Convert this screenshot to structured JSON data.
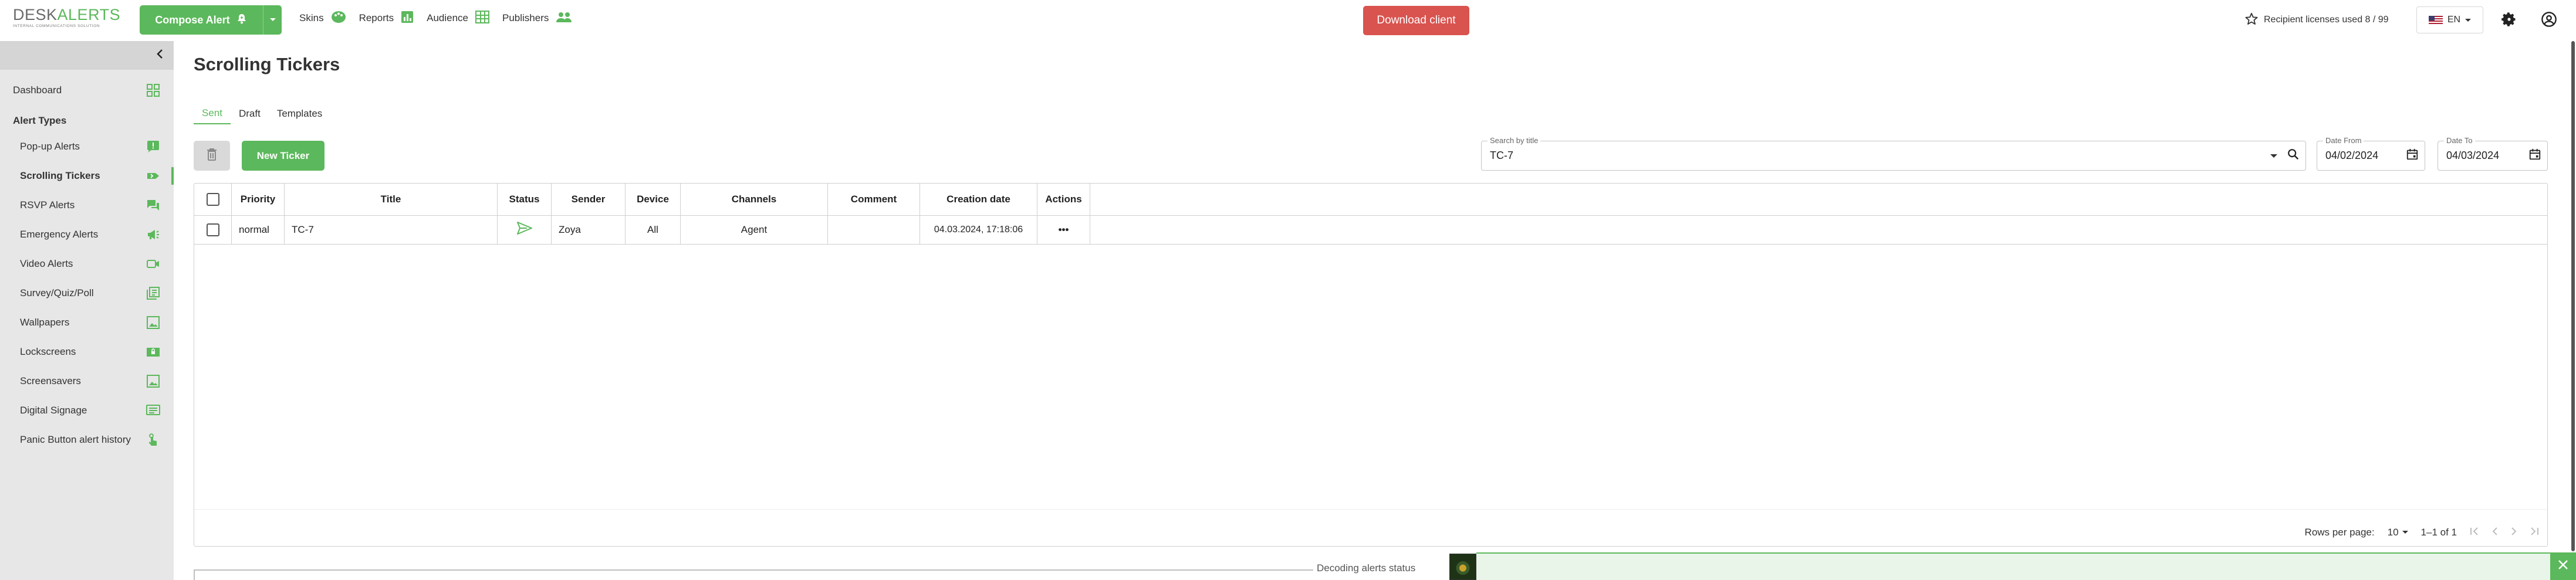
{
  "header": {
    "logo_main_a": "DESK",
    "logo_main_b": "ALERTS",
    "logo_sub": "INTERNAL COMMUNICATIONS SOLUTION",
    "compose_label": "Compose Alert",
    "nav": [
      {
        "label": "Skins",
        "icon": "palette-icon"
      },
      {
        "label": "Reports",
        "icon": "chart-icon"
      },
      {
        "label": "Audience",
        "icon": "table-icon"
      },
      {
        "label": "Publishers",
        "icon": "people-icon"
      }
    ],
    "download_label": "Download client",
    "licenses_label": "Recipient licenses used 8 / 99",
    "language": "EN"
  },
  "sidebar": {
    "dashboard_label": "Dashboard",
    "alert_types_heading": "Alert Types",
    "items": [
      {
        "label": "Pop-up Alerts",
        "icon": "popup-icon"
      },
      {
        "label": "Scrolling Tickers",
        "icon": "ticker-icon",
        "active": true
      },
      {
        "label": "RSVP Alerts",
        "icon": "chat-icon"
      },
      {
        "label": "Emergency Alerts",
        "icon": "megaphone-icon"
      },
      {
        "label": "Video Alerts",
        "icon": "video-icon"
      },
      {
        "label": "Survey/Quiz/Poll",
        "icon": "survey-icon"
      },
      {
        "label": "Wallpapers",
        "icon": "image-icon"
      },
      {
        "label": "Lockscreens",
        "icon": "lockscreen-icon"
      },
      {
        "label": "Screensavers",
        "icon": "screensaver-icon"
      },
      {
        "label": "Digital Signage",
        "icon": "signage-icon"
      },
      {
        "label": "Panic Button alert history",
        "icon": "hand-icon"
      }
    ]
  },
  "main": {
    "title": "Scrolling Tickers",
    "tabs": [
      "Sent",
      "Draft",
      "Templates"
    ],
    "active_tab": "Sent",
    "new_button": "New Ticker",
    "search": {
      "legend": "Search by title",
      "value": "TC-7"
    },
    "date_from": {
      "legend": "Date From",
      "value": "04/02/2024"
    },
    "date_to": {
      "legend": "Date To",
      "value": "04/03/2024"
    },
    "table": {
      "columns": [
        "Priority",
        "Title",
        "Status",
        "Sender",
        "Device",
        "Channels",
        "Comment",
        "Creation date",
        "Actions"
      ],
      "rows": [
        {
          "priority": "normal",
          "title": "TC-7",
          "status": "sent",
          "sender": "Zoya",
          "device": "All",
          "channels": "Agent",
          "comment": "",
          "creation_date": "04.03.2024, 17:18:06",
          "actions": "•••"
        }
      ]
    },
    "pager": {
      "rows_per_page_label": "Rows per page:",
      "rows_per_page": "10",
      "range": "1–1 of 1"
    }
  },
  "bottom": {
    "status_label": "Decoding alerts status"
  },
  "colors": {
    "accent": "#5cb85c",
    "danger": "#d9534f",
    "sidebar_bg": "#e7e7e7"
  }
}
